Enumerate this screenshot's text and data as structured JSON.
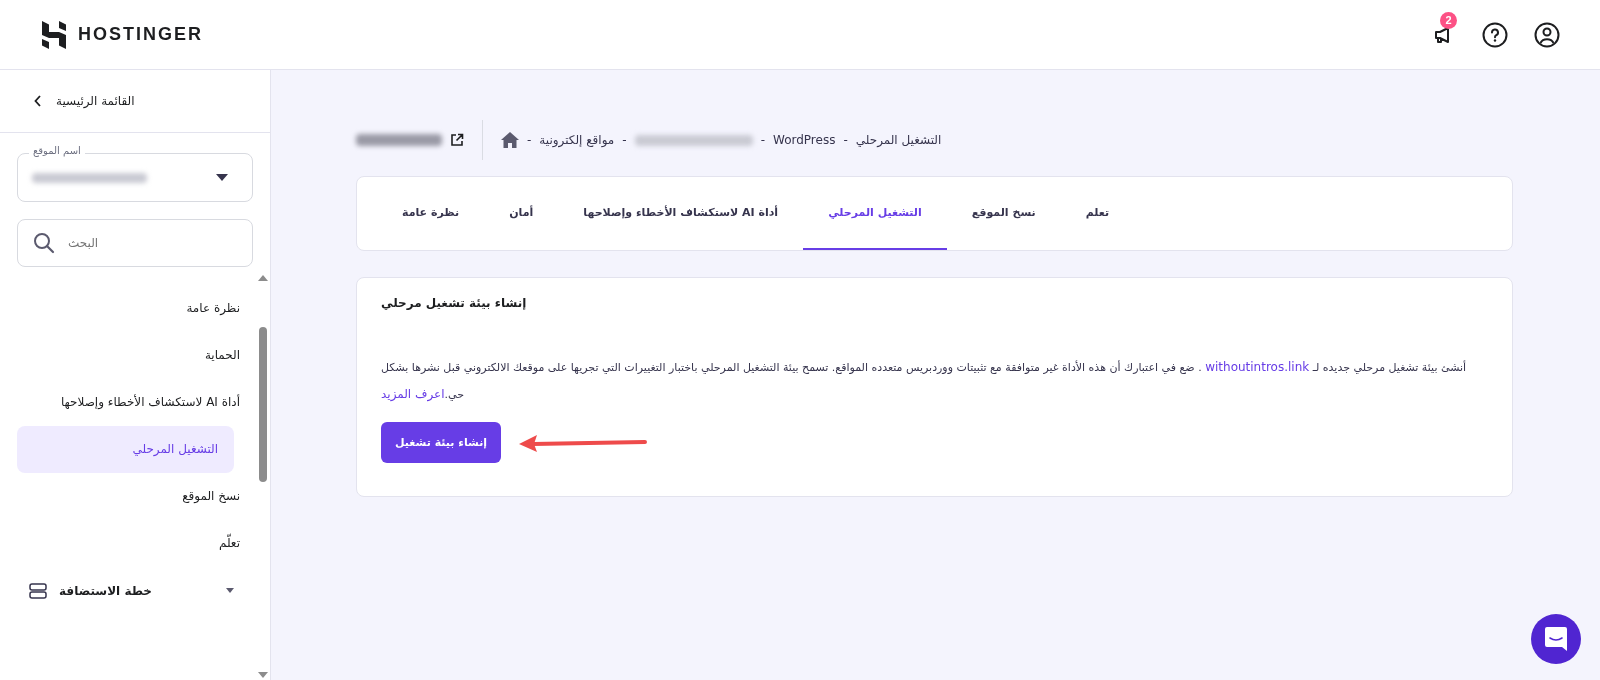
{
  "header": {
    "logo_text": "HOSTINGER",
    "notifications_count": "2"
  },
  "sidebar": {
    "back_label": "القائمة الرئيسية",
    "site_select": {
      "label": "اسم الموقع"
    },
    "search": {
      "placeholder": "البحث"
    },
    "items": [
      {
        "label": "نظرة عامة",
        "selected": false
      },
      {
        "label": "الحماية",
        "selected": false
      },
      {
        "label": "أداة AI لاستكشاف الأخطاء وإصلاحها",
        "selected": false
      },
      {
        "label": "التشغيل المرحلي",
        "selected": true
      },
      {
        "label": "نسخ الموقع",
        "selected": false
      },
      {
        "label": "تعلّم",
        "selected": false
      }
    ],
    "sections": [
      {
        "label": "خطة الاستضافة",
        "expanded": false
      }
    ]
  },
  "breadcrumb": {
    "separator": "-",
    "items": [
      {
        "kind": "text",
        "label": "التشغيل المرحلي"
      },
      {
        "kind": "text",
        "label": "WordPress"
      },
      {
        "kind": "redacted"
      },
      {
        "kind": "text",
        "label": "مواقع إلكترونية"
      },
      {
        "kind": "home"
      }
    ]
  },
  "tabs": [
    {
      "label": "تعلم",
      "selected": false
    },
    {
      "label": "نسخ الموقع",
      "selected": false
    },
    {
      "label": "التشغيل المرحلي",
      "selected": true
    },
    {
      "label": "أداة AI لاستكشاف الأخطاء وإصلاحها",
      "selected": false
    },
    {
      "label": "أمان",
      "selected": false
    },
    {
      "label": "نظرة عامة",
      "selected": false
    }
  ],
  "card": {
    "title": "إنشاء بيئة تشغيل مرحلي",
    "text_before": "أنشئ بيئة تشغيل مرحلي جديده لـ",
    "site_link": "withoutintros.link",
    "text_after": ". ضع في اعتبارك أن هذه الأداة غير متوافقة مع تثبيتات ووردبريس متعدده المواقع. تسمح بيئة التشغيل المرحلي باختبار التغييرات التي تجريها على موقعك الالكتروني قبل نشرها بشكل حي.",
    "learn_link": "اعرف المزيد",
    "button": "إنشاء بيئة تشغيل"
  }
}
